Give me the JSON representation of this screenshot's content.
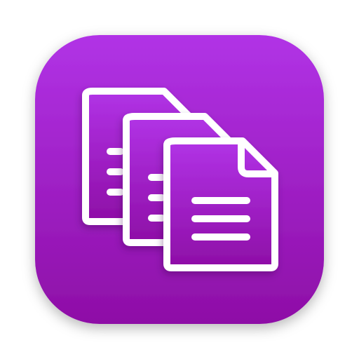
{
  "app_icon": {
    "icon": "documents-stack-icon",
    "colors": {
      "gradient_top": "#B133E6",
      "gradient_bottom": "#8E0EA6",
      "glyph": "#FFFFFF"
    }
  }
}
